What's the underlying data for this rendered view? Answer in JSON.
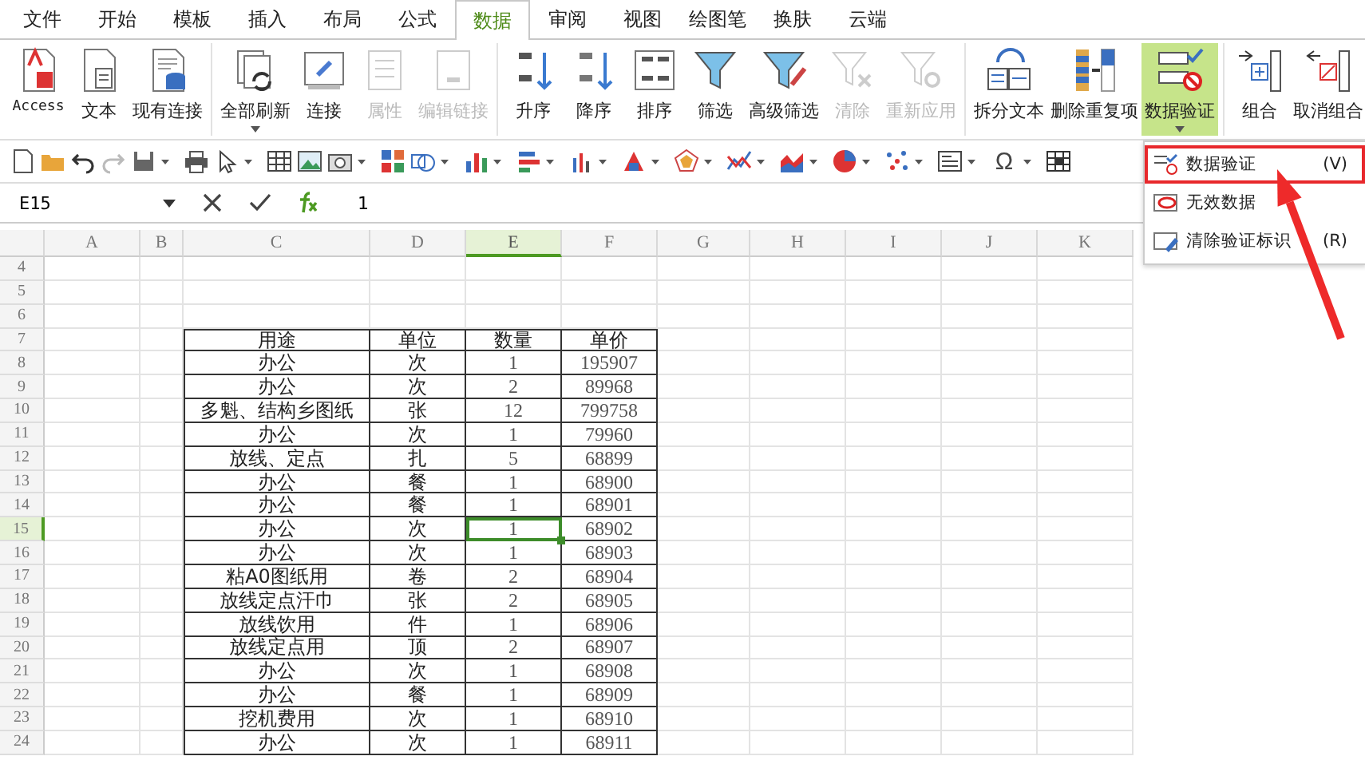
{
  "menu_tabs": [
    {
      "label": "文件",
      "selected": false
    },
    {
      "label": "开始",
      "selected": false
    },
    {
      "label": "模板",
      "selected": false
    },
    {
      "label": "插入",
      "selected": false
    },
    {
      "label": "布局",
      "selected": false
    },
    {
      "label": "公式",
      "selected": false
    },
    {
      "label": "数据",
      "selected": true
    },
    {
      "label": "审阅",
      "selected": false
    },
    {
      "label": "视图",
      "selected": false
    },
    {
      "label": "绘图笔",
      "selected": false
    },
    {
      "label": "换肤",
      "selected": false
    },
    {
      "label": "云端",
      "selected": false
    }
  ],
  "ribbon_groups": [
    {
      "buttons": [
        {
          "label": "Access",
          "kind": "access",
          "disabled": false,
          "dropdown": false,
          "selected": false
        },
        {
          "label": "文本",
          "kind": "textfile",
          "disabled": false,
          "dropdown": false,
          "selected": false
        },
        {
          "label": "现有连接",
          "kind": "dbfile",
          "disabled": false,
          "dropdown": false,
          "selected": false
        }
      ]
    },
    {
      "buttons": [
        {
          "label": "全部刷新",
          "kind": "refresh",
          "disabled": false,
          "dropdown": true,
          "selected": false
        },
        {
          "label": "连接",
          "kind": "link",
          "disabled": false,
          "dropdown": false,
          "selected": false
        },
        {
          "label": "属性",
          "kind": "props",
          "disabled": true,
          "dropdown": false,
          "selected": false
        },
        {
          "label": "编辑链接",
          "kind": "editlink",
          "disabled": true,
          "dropdown": false,
          "selected": false
        }
      ]
    },
    {
      "buttons": [
        {
          "label": "升序",
          "kind": "sortasc",
          "disabled": false,
          "dropdown": false,
          "selected": false
        },
        {
          "label": "降序",
          "kind": "sortdesc",
          "disabled": false,
          "dropdown": false,
          "selected": false
        },
        {
          "label": "排序",
          "kind": "sort",
          "disabled": false,
          "dropdown": false,
          "selected": false
        },
        {
          "label": "筛选",
          "kind": "filter",
          "disabled": false,
          "dropdown": false,
          "selected": false
        },
        {
          "label": "高级筛选",
          "kind": "advfilter",
          "disabled": false,
          "dropdown": false,
          "selected": false
        },
        {
          "label": "清除",
          "kind": "clearfilter",
          "disabled": true,
          "dropdown": false,
          "selected": false
        },
        {
          "label": "重新应用",
          "kind": "reapply",
          "disabled": true,
          "dropdown": false,
          "selected": false
        }
      ]
    },
    {
      "buttons": [
        {
          "label": "拆分文本",
          "kind": "split",
          "disabled": false,
          "dropdown": false,
          "selected": false
        },
        {
          "label": "删除重复项",
          "kind": "dedupe",
          "disabled": false,
          "dropdown": false,
          "selected": false
        },
        {
          "label": "数据验证",
          "kind": "validate",
          "disabled": false,
          "dropdown": true,
          "selected": true
        }
      ]
    },
    {
      "buttons": [
        {
          "label": "组合",
          "kind": "group",
          "disabled": false,
          "dropdown": false,
          "selected": false
        },
        {
          "label": "取消组合",
          "kind": "ungroup",
          "disabled": false,
          "dropdown": false,
          "selected": false
        }
      ]
    }
  ],
  "toolbar": {
    "symbol": "Ω"
  },
  "formula_bar": {
    "cell_ref": "E15",
    "value": "1"
  },
  "dropdown_menu": [
    {
      "label": "数据验证",
      "shortcut": "(V)",
      "kind": "validate",
      "selected": true
    },
    {
      "label": "无效数据",
      "kind": "invalid",
      "selected": false
    },
    {
      "label": "清除验证标识",
      "shortcut": "(R)",
      "kind": "clear",
      "selected": false
    }
  ],
  "sheet": {
    "columns": [
      {
        "label": "A",
        "selected": false
      },
      {
        "label": "B",
        "selected": false
      },
      {
        "label": "C",
        "selected": false
      },
      {
        "label": "D",
        "selected": false
      },
      {
        "label": "E",
        "selected": true
      },
      {
        "label": "F",
        "selected": false
      },
      {
        "label": "G",
        "selected": false
      },
      {
        "label": "H",
        "selected": false
      },
      {
        "label": "I",
        "selected": false
      },
      {
        "label": "J",
        "selected": false
      },
      {
        "label": "K",
        "selected": false
      }
    ],
    "rows": [
      {
        "label": "4",
        "selected": false
      },
      {
        "label": "5",
        "selected": false
      },
      {
        "label": "6",
        "selected": false
      },
      {
        "label": "7",
        "selected": false
      },
      {
        "label": "8",
        "selected": false
      },
      {
        "label": "9",
        "selected": false
      },
      {
        "label": "10",
        "selected": false
      },
      {
        "label": "11",
        "selected": false
      },
      {
        "label": "12",
        "selected": false
      },
      {
        "label": "13",
        "selected": false
      },
      {
        "label": "14",
        "selected": false
      },
      {
        "label": "15",
        "selected": true
      },
      {
        "label": "16",
        "selected": false
      },
      {
        "label": "17",
        "selected": false
      },
      {
        "label": "18",
        "selected": false
      },
      {
        "label": "19",
        "selected": false
      },
      {
        "label": "20",
        "selected": false
      },
      {
        "label": "21",
        "selected": false
      },
      {
        "label": "22",
        "selected": false
      },
      {
        "label": "23",
        "selected": false
      },
      {
        "label": "24",
        "selected": false
      }
    ]
  },
  "table": {
    "header": [
      "用途",
      "单位",
      "数量",
      "单价"
    ],
    "rows": [
      [
        "办公",
        "次",
        "1",
        "195907"
      ],
      [
        "办公",
        "次",
        "2",
        "89968"
      ],
      [
        "多魁、结构乡图纸",
        "张",
        "12",
        "799758"
      ],
      [
        "办公",
        "次",
        "1",
        "79960"
      ],
      [
        "放线、定点",
        "扎",
        "5",
        "68899"
      ],
      [
        "办公",
        "餐",
        "1",
        "68900"
      ],
      [
        "办公",
        "餐",
        "1",
        "68901"
      ],
      [
        "办公",
        "次",
        "1",
        "68902"
      ],
      [
        "办公",
        "次",
        "1",
        "68903"
      ],
      [
        "粘A0图纸用",
        "卷",
        "2",
        "68904"
      ],
      [
        "放线定点汗巾",
        "张",
        "2",
        "68905"
      ],
      [
        "放线饮用",
        "件",
        "1",
        "68906"
      ],
      [
        "放线定点用",
        "顶",
        "2",
        "68907"
      ],
      [
        "办公",
        "次",
        "1",
        "68908"
      ],
      [
        "办公",
        "餐",
        "1",
        "68909"
      ],
      [
        "挖机费用",
        "次",
        "1",
        "68910"
      ],
      [
        "办公",
        "次",
        "1",
        "68911"
      ]
    ]
  }
}
